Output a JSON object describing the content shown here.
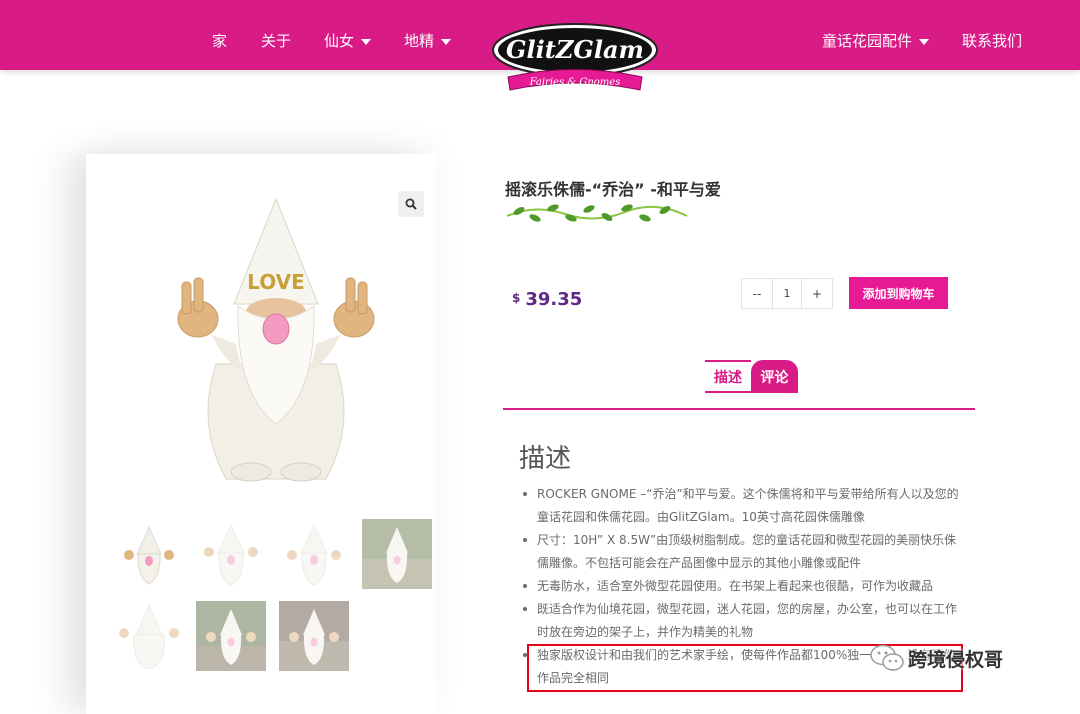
{
  "nav": {
    "home": "家",
    "about": "关于",
    "fairies": "仙女",
    "gnomes": "地精",
    "garden_accessories": "童话花园配件",
    "contact": "联系我们"
  },
  "logo": {
    "brand": "GlitZGlam",
    "tagline": "Fairies & Gnomes"
  },
  "product": {
    "title": "摇滚乐侏儒-“乔治” -和平与爱",
    "currency": "$",
    "price": "39.35",
    "hat_text": "LOVE"
  },
  "cart": {
    "minus": "--",
    "quantity": "1",
    "plus": "+",
    "add_label": "添加到购物车"
  },
  "tabs": {
    "description": "描述",
    "reviews": "评论"
  },
  "description": {
    "heading": "描述",
    "bullets": [
      "ROCKER GNOME –“乔治”和平与爱。这个侏儒将和平与爱带给所有人以及您的童话花园和侏儒花园。由GlitZGlam。10英寸高花园侏儒雕像",
      "尺寸：10H” X 8.5W”由顶级树脂制成。您的童话花园和微型花园的美丽快乐侏儒雕像。不包括可能会在产品图像中显示的其他小雕像或配件",
      "无毒防水，适合室外微型花园使用。在书架上看起来也很酷，可作为收藏品",
      "既适合作为仙境花园，微型花园，迷人花园，您的房屋，办公室，也可以在工作时放在旁边的架子上，并作为精美的礼物",
      "独家版权设计和由我们的艺术家手绘，使每件作品都100%独一无二，没有两件作品完全相同"
    ]
  },
  "watermark": "跨境侵权哥",
  "colors": {
    "brand_magenta": "#d81b86",
    "button_pink": "#e71a95",
    "price_purple": "#5e2a8a",
    "highlight_red": "#e6001a"
  }
}
